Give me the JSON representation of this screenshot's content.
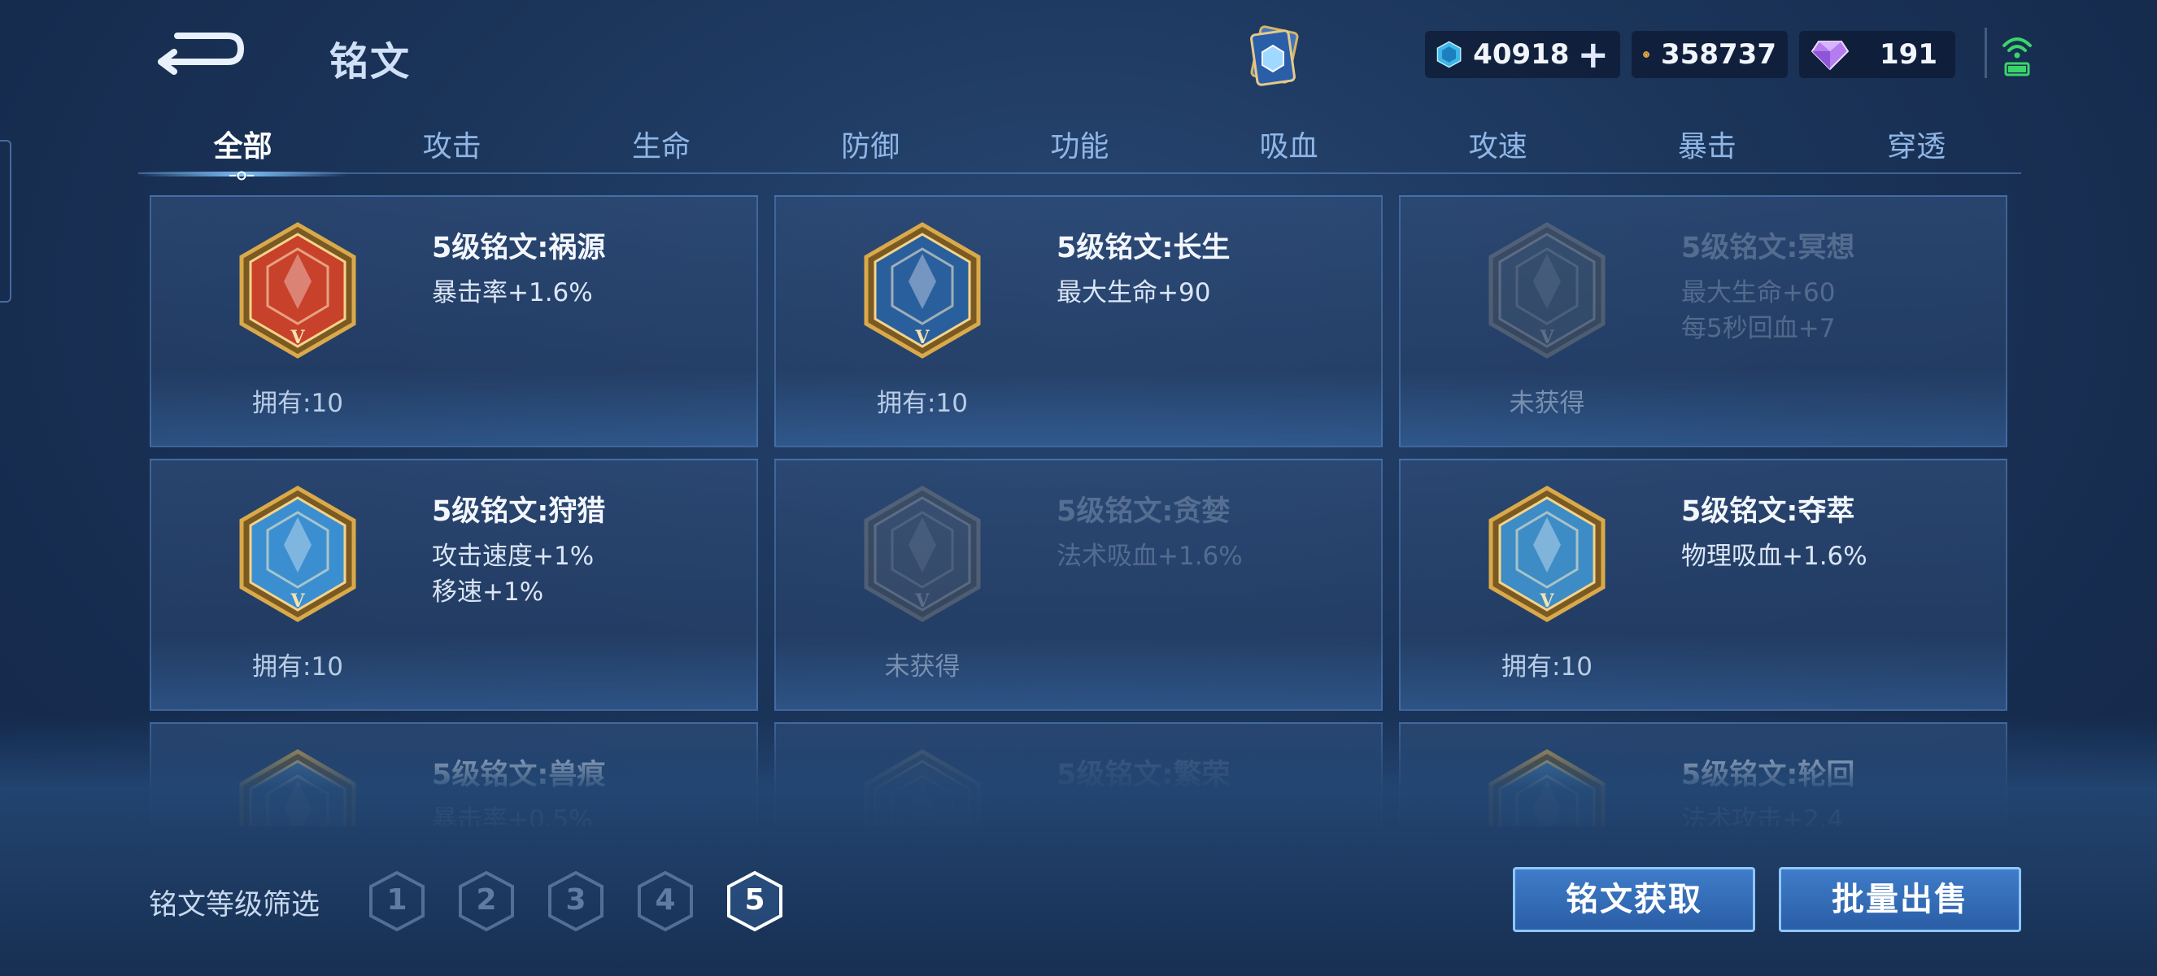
{
  "header": {
    "title": "铭文",
    "back_icon": "back-arrow-icon",
    "card_icon": "inscription-cardbook-icon"
  },
  "currencies": [
    {
      "icon": "diamond-crystal-icon",
      "value": "40918",
      "has_plus": true
    },
    {
      "icon": "gold-coin-icon",
      "value": "358737"
    },
    {
      "icon": "purple-gem-icon",
      "value": "191"
    }
  ],
  "tabs": [
    "全部",
    "攻击",
    "生命",
    "防御",
    "功能",
    "吸血",
    "攻速",
    "暴击",
    "穿透"
  ],
  "active_tab": "全部",
  "inscriptions": [
    {
      "name": "5级铭文:祸源",
      "stats": [
        "暴击率+1.6%"
      ],
      "status": "拥有:10",
      "owned": true,
      "color": "#c8412a"
    },
    {
      "name": "5级铭文:长生",
      "stats": [
        "最大生命+90"
      ],
      "status": "拥有:10",
      "owned": true,
      "color": "#2a5f9e"
    },
    {
      "name": "5级铭文:冥想",
      "stats": [
        "最大生命+60",
        "每5秒回血+7"
      ],
      "status": "未获得",
      "owned": false,
      "color": "#3c6a8a"
    },
    {
      "name": "5级铭文:狩猎",
      "stats": [
        "攻击速度+1%",
        "移速+1%"
      ],
      "status": "拥有:10",
      "owned": true,
      "color": "#3b8fd0"
    },
    {
      "name": "5级铭文:贪婪",
      "stats": [
        "法术吸血+1.6%"
      ],
      "status": "未获得",
      "owned": false,
      "color": "#4a6a90"
    },
    {
      "name": "5级铭文:夺萃",
      "stats": [
        "物理吸血+1.6%"
      ],
      "status": "拥有:10",
      "owned": true,
      "color": "#3d8cc6"
    },
    {
      "name": "5级铭文:兽痕",
      "stats": [
        "暴击率+0.5%"
      ],
      "status": "",
      "owned": true,
      "color": "#4f7ea8"
    },
    {
      "name": "5级铭文:繁荣",
      "stats": [
        ""
      ],
      "status": "",
      "owned": false,
      "color": "#4a6a90"
    },
    {
      "name": "5级铭文:轮回",
      "stats": [
        "法术攻击+2.4"
      ],
      "status": "",
      "owned": true,
      "color": "#4f88b8"
    }
  ],
  "filter": {
    "label": "铭文等级筛选",
    "levels": [
      "1",
      "2",
      "3",
      "4",
      "5"
    ],
    "active": "5"
  },
  "actions": {
    "obtain": "铭文获取",
    "sell": "批量出售"
  },
  "colors": {
    "accent": "#8fc5ff",
    "gold_frame": "#d9a94a",
    "tab_inactive": "#8fb6e6"
  }
}
